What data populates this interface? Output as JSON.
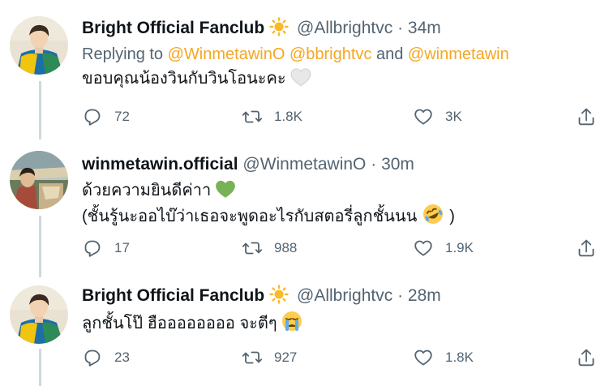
{
  "tweets": [
    {
      "name": "Bright Official Fanclub",
      "handle": "@Allbrightvc",
      "time": "34m",
      "reply_prefix": "Replying to ",
      "mention1": "@WinmetawinO",
      "mention2": "@bbrightvc",
      "reply_and": " and ",
      "mention3": "@winmetawin",
      "text": "ขอบคุณน้องวินกับวินโอนะคะ",
      "emoji": "white-heart-icon",
      "replies": "72",
      "retweets": "1.8K",
      "likes": "3K"
    },
    {
      "name": "winmetawin.official",
      "handle": "@WinmetawinO",
      "time": "30m",
      "text": "ด้วยความยินดีค่าา",
      "emoji": "green-heart-icon",
      "text2_a": "(ชั้นรู้นะออไบ๊ว่าเธอจะพูดอะไรกับสตอรี่ลูกชั้นนน",
      "text2_b": ")",
      "emoji2": "rolling-laughing-icon",
      "replies": "17",
      "retweets": "988",
      "likes": "1.9K"
    },
    {
      "name": "Bright Official Fanclub",
      "handle": "@Allbrightvc",
      "time": "28m",
      "text": "ลูกชั้นโป๊ ฮืออออออออ จะตีๆ",
      "emoji": "crying-face-icon",
      "replies": "23",
      "retweets": "927",
      "likes": "1.8K"
    }
  ],
  "separator": "·",
  "colors": {
    "mention": "#f5a623",
    "secondary_text": "#536471",
    "thread_line": "#cfd9de",
    "icon": "#536471"
  }
}
